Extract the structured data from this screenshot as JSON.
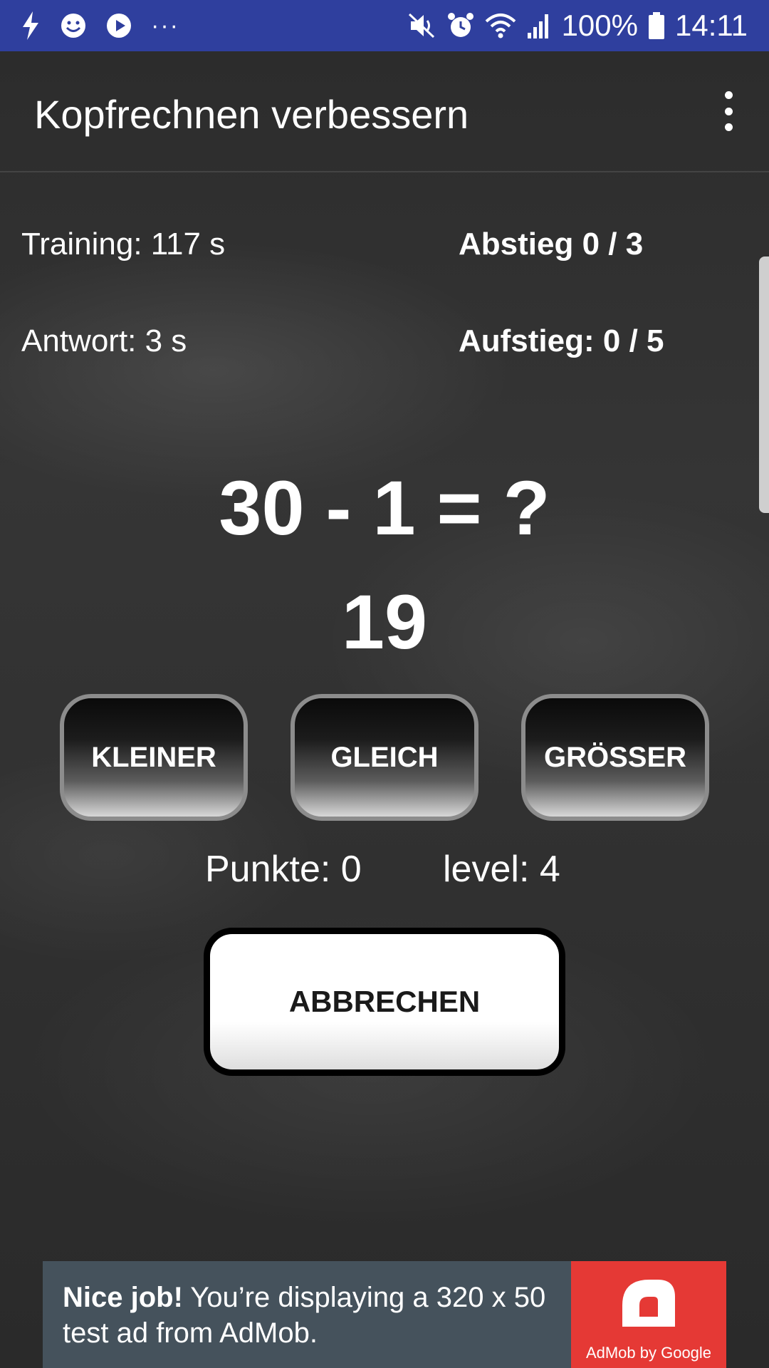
{
  "status_bar": {
    "battery": "100%",
    "time": "14:11",
    "more_dots": "···"
  },
  "app_bar": {
    "title": "Kopfrechnen verbessern",
    "menu_icon": "more-vert-icon"
  },
  "stats": {
    "training": "Training: 117 s",
    "answer": "Antwort: 3 s",
    "descent": "Abstieg 0 / 3",
    "ascent": "Aufstieg: 0 / 5"
  },
  "task": {
    "equation": "30 - 1 = ?",
    "current_number": "19"
  },
  "buttons": {
    "smaller": "KLEINER",
    "equal": "GLEICH",
    "greater": "GRÖSSER",
    "cancel": "ABBRECHEN"
  },
  "score": {
    "points": "Punkte: 0",
    "level": "level: 4"
  },
  "ad": {
    "headline": "Nice job!",
    "body": " You’re displaying a 320 x 50 test ad from AdMob.",
    "logo_caption": "AdMob by Google",
    "background_color": "#45525c",
    "logo_color": "#e53935"
  },
  "colors": {
    "status_bar": "#2f3f9e",
    "text": "#ffffff"
  }
}
